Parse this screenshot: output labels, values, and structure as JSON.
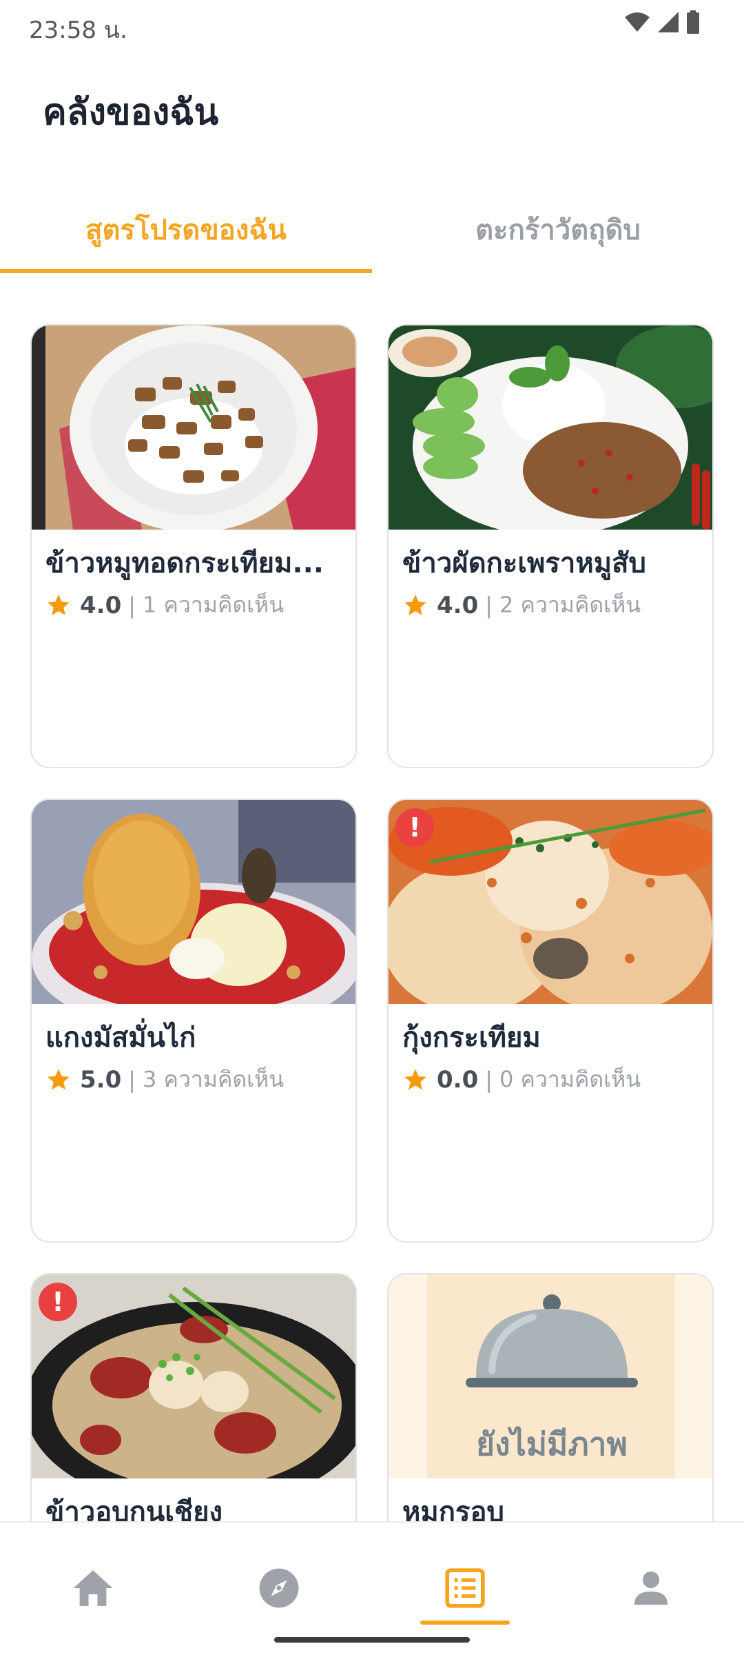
{
  "status_bar": {
    "time": "23:58 น."
  },
  "header": {
    "title": "คลังของฉัน"
  },
  "tabs": [
    {
      "label": "สูตรโปรดของฉัน",
      "active": true
    },
    {
      "label": "ตะกร้าวัตถุดิบ",
      "active": false
    }
  ],
  "recipes": [
    {
      "title": "ข้าวหมูทอดกระเทียม...",
      "rating": "4.0",
      "separator": "|",
      "comments": "1 ความคิดเห็น",
      "image": "fried-pork-garlic-rice-photo",
      "alert": false
    },
    {
      "title": "ข้าวผัดกะเพราหมูสับ",
      "rating": "4.0",
      "separator": "|",
      "comments": "2 ความคิดเห็น",
      "image": "basil-minced-pork-rice-photo",
      "alert": false
    },
    {
      "title": "แกงมัสมั่นไก่",
      "rating": "5.0",
      "separator": "|",
      "comments": "3 ความคิดเห็น",
      "image": "chicken-massaman-curry-photo",
      "alert": false
    },
    {
      "title": "กุ้งกระเทียม",
      "rating": "0.0",
      "separator": "|",
      "comments": "0 ความคิดเห็น",
      "image": "garlic-shrimp-photo",
      "alert": true,
      "alert_symbol": "!"
    },
    {
      "title": "ข้าวอบกุนเชียง",
      "rating": "",
      "separator": "",
      "comments": "",
      "image": "baked-rice-chinese-sausage-photo",
      "alert": true,
      "alert_symbol": "!"
    },
    {
      "title": "หมูกรอบ",
      "rating": "",
      "separator": "",
      "comments": "",
      "image": "no-image-placeholder",
      "alert": false,
      "placeholder_text": "ยังไม่มีภาพ"
    }
  ],
  "bottom_nav": [
    {
      "icon": "home-icon",
      "active": false
    },
    {
      "icon": "compass-icon",
      "active": false
    },
    {
      "icon": "list-icon",
      "active": true
    },
    {
      "icon": "person-icon",
      "active": false
    }
  ],
  "colors": {
    "accent": "#f7a421",
    "star": "#f59b0c",
    "alert": "#e94040",
    "title_text": "#1f2a3a",
    "muted_text": "#9ea2a8"
  }
}
